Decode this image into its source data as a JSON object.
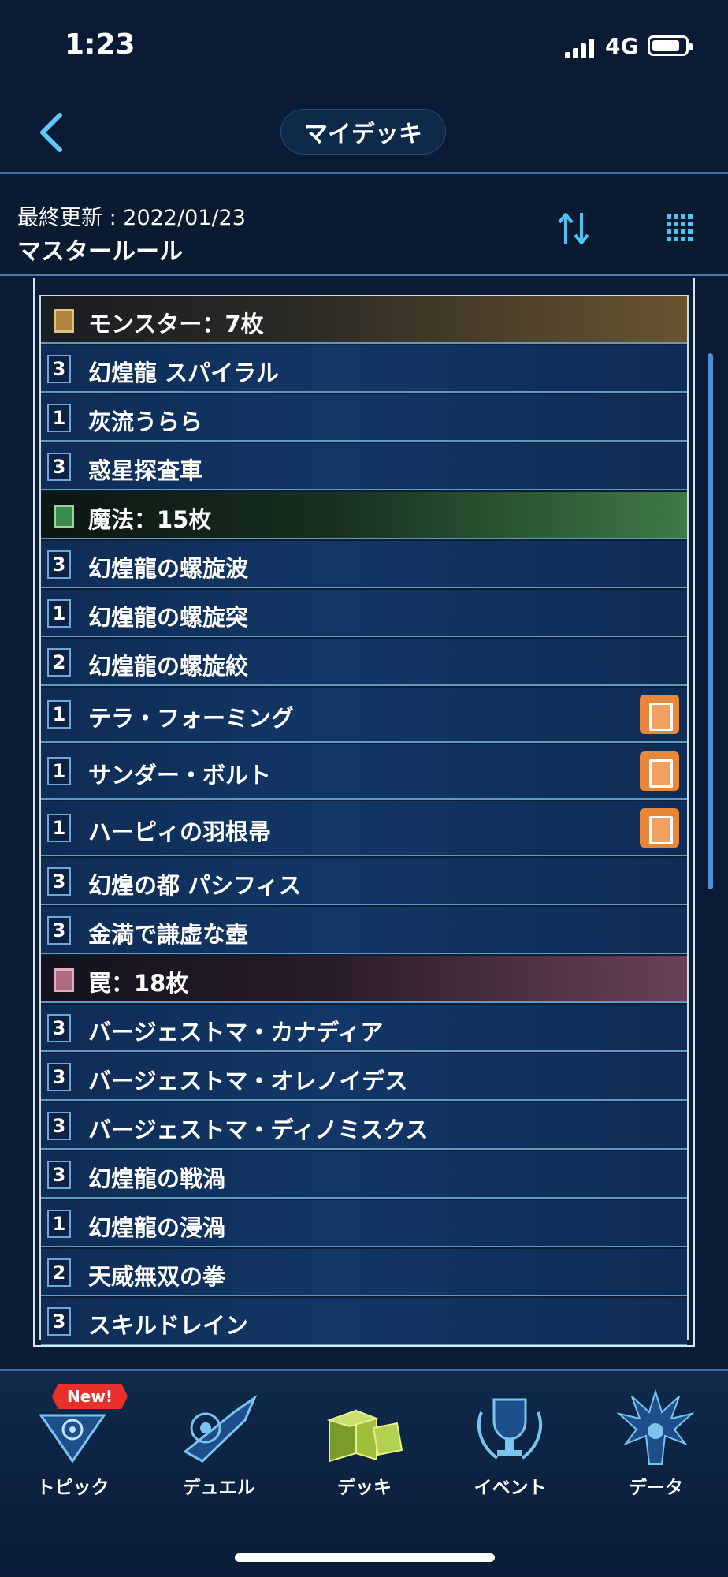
{
  "status_bar": {
    "time": "1:23",
    "network": "4G"
  },
  "header": {
    "title": "マイデッキ"
  },
  "info": {
    "last_updated": "最終更新 : 2022/01/23",
    "rule": "マスタールール"
  },
  "sections": {
    "monster": "モンスター：7枚",
    "spell": "魔法：15枚",
    "trap": "罠：18枚"
  },
  "cards": [
    {
      "count": "3",
      "name": "幻煌龍 スパイラル"
    },
    {
      "count": "1",
      "name": "灰流うらら"
    },
    {
      "count": "3",
      "name": "惑星探査車"
    },
    {
      "count": "3",
      "name": "幻煌龍の螺旋波"
    },
    {
      "count": "1",
      "name": "幻煌龍の螺旋突"
    },
    {
      "count": "2",
      "name": "幻煌龍の螺旋絞"
    },
    {
      "count": "1",
      "name": "テラ・フォーミング"
    },
    {
      "count": "1",
      "name": "サンダー・ボルト"
    },
    {
      "count": "1",
      "name": "ハーピィの羽根帚"
    },
    {
      "count": "3",
      "name": "幻煌の都 パシフィス"
    },
    {
      "count": "3",
      "name": "金満で謙虚な壺"
    },
    {
      "count": "3",
      "name": "バージェストマ・カナディア"
    },
    {
      "count": "3",
      "name": "バージェストマ・オレノイデス"
    },
    {
      "count": "3",
      "name": "バージェストマ・ディノミスクス"
    },
    {
      "count": "3",
      "name": "幻煌龍の戦渦"
    },
    {
      "count": "1",
      "name": "幻煌龍の浸渦"
    },
    {
      "count": "2",
      "name": "天威無双の拳"
    },
    {
      "count": "3",
      "name": "スキルドレイン"
    }
  ],
  "nav": {
    "new_badge": "New!",
    "items": [
      "トピック",
      "デュエル",
      "デッキ",
      "イベント",
      "データ"
    ]
  },
  "colors": {
    "background": "#0b1a35",
    "row": "#123766",
    "accent": "#4ec3f0",
    "monster": "#6a5530",
    "spell": "#3e7a48",
    "trap": "#6a4258",
    "limited_badge": "#e8873a"
  }
}
